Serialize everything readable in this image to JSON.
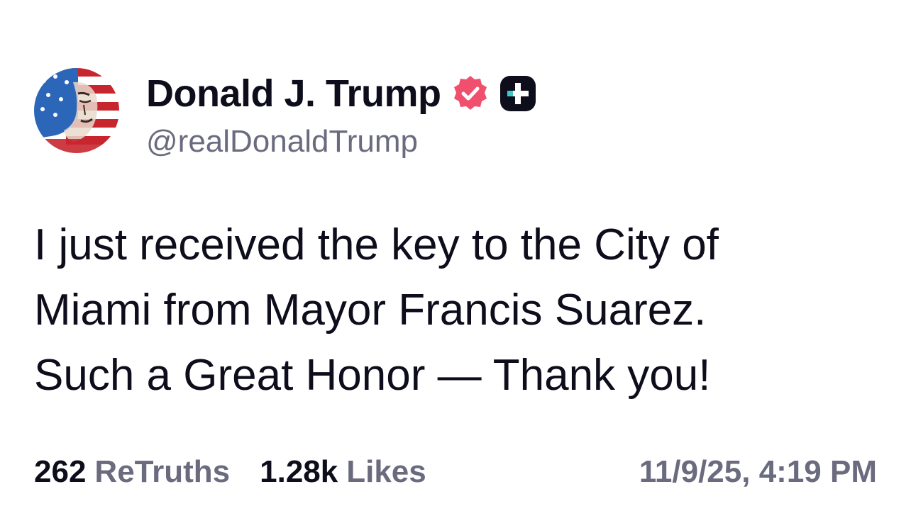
{
  "author": {
    "display_name": "Donald J. Trump",
    "handle": "@realDonaldTrump",
    "avatar_icon": "avatar-flag-portrait",
    "badges": [
      "verified-icon",
      "truth-plus-icon"
    ]
  },
  "post": {
    "text": "I just received the key to the City of\nMiami from Mayor Francis Suarez.\nSuch a Great Honor — Thank you!"
  },
  "stats": {
    "retruths_count": "262",
    "retruths_label": "ReTruths",
    "likes_count": "1.28k",
    "likes_label": "Likes",
    "timestamp": "11/9/25, 4:19 PM"
  },
  "colors": {
    "text_primary": "#0d0d1b",
    "text_secondary": "#6b6b80",
    "verified_badge": "#f0506e",
    "plus_badge_bg": "#0d0d1b",
    "plus_badge_accent": "#3cc8c8"
  }
}
